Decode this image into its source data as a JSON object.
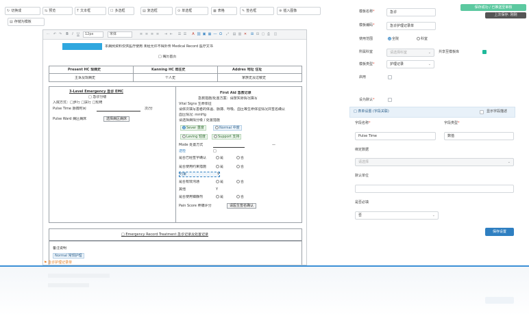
{
  "toolbar": {
    "buttons": [
      {
        "icon": "↻",
        "label": "切换成"
      },
      {
        "icon": "⇆",
        "label": "预览"
      },
      {
        "icon": "T",
        "label": "文本框"
      },
      {
        "icon": "☐",
        "label": "多选框"
      },
      {
        "icon": "▤",
        "label": "复选框"
      },
      {
        "icon": "⊙",
        "label": "单选框"
      },
      {
        "icon": "▦",
        "label": "表格"
      },
      {
        "icon": "✎",
        "label": "签名框"
      },
      {
        "icon": "⊕",
        "label": "插入图像"
      }
    ],
    "second_row_button": {
      "icon": "▤",
      "label": "存储为模板"
    }
  },
  "notification": {
    "label": "保存成功 / 已推送至审核",
    "sub": "上次保存: 刚刚"
  },
  "editor": {
    "toolbar": {
      "font_size": "12px",
      "font_family": "宋体"
    },
    "doc": {
      "header_line": "本病例资料仅供医疗使用 未经允许不得外传 Medical Record 医疗文书",
      "header_sub": "□ 病历首页",
      "table_headers": [
        "Present HC 现病史",
        "Kanning HC 既往史",
        "Addres 地址 住址"
      ],
      "table_values": [
        "主诉及现病史",
        "个人史",
        "家族史及过敏史"
      ],
      "left_box": {
        "title": "3-Level Emergency 急诊 EMC",
        "subtitle": "□ 急诊分级",
        "line1": "入院方式：□步行 □扶行 □轮椅",
        "line2_label": "Pulse Time 脉搏时间",
        "line2_value": "次/分",
        "line3_label": "Pulse Ward 病区病床",
        "line3_button": "选择病区病床"
      },
      "right_box": {
        "title": "First Aid 急救记录",
        "line1": "急救措施/处置方案：请按实际情况填写",
        "line2": "Vital Signs 生命体征",
        "line3": "请依次填写患者的体温、脉搏、呼吸、血压等生命体征情况并签名确认",
        "line4": "血压情况: mmHg",
        "line5": "请选择病情分级 / 处置措施",
        "chips": [
          "Sever 重度",
          "Normal 中度",
          "Leving 轻度",
          "Support 支持"
        ],
        "rows": [
          {
            "label": "Mode 处置方式",
            "value": "—"
          },
          {
            "label": "送检",
            "value": "□"
          },
          {
            "label": "是否已经签字确认",
            "opt1": "是",
            "opt2": "否"
          },
          {
            "label": "是否使用约束措施",
            "opt1": "是",
            "opt2": "否"
          },
          {
            "label": "约束",
            "value": "Y"
          },
          {
            "label": "是否有效沟通",
            "opt1": "是",
            "opt2": "否"
          },
          {
            "label": "其他",
            "value": "Y"
          },
          {
            "label": "是否使用镇静剂",
            "opt1": "是",
            "opt2": "否"
          }
        ],
        "sign_label": "Pain Score 疼痛评分",
        "sign_button": "请医生签名确认"
      },
      "section2_title": "□ Emergency Record Treatment 急诊记录及处置记录",
      "lower_label": "备注说明",
      "lower_chip": "Normal 常规护理",
      "floating_label": "急诊护理记录单"
    }
  },
  "form": {
    "fields": [
      {
        "label": "模板名称",
        "value": "急诊"
      },
      {
        "label": "模板编码",
        "value": "急诊护理记录单"
      }
    ],
    "scope_label": "使用范围",
    "scope_options": [
      "全院",
      "科室"
    ],
    "dept_label": "所属科室",
    "dept_placeholder": "请选择科室",
    "share_label": "共享至模板库",
    "type_label": "模板类型",
    "type_value": "护理记录",
    "enable_label": "启用",
    "default_label": "设为默认",
    "section_title": "□ 表单设置 (字段关联)",
    "section_check_label": "显示字段描述",
    "col_field_label": "字段名称",
    "col_type_label": "字段类型",
    "field_name_value": "Pulse Time",
    "field_type_value": "数值",
    "bind_label": "绑定数据",
    "bind_placeholder": "请选择",
    "unit_label": "默认单位",
    "unit_value": "",
    "required_label": "是否必填",
    "required_value": "否",
    "save_button": "保存设置"
  },
  "colors": {
    "accent": "#2f7fc1",
    "success": "#1fb99a",
    "band": "#3a8fd6"
  }
}
